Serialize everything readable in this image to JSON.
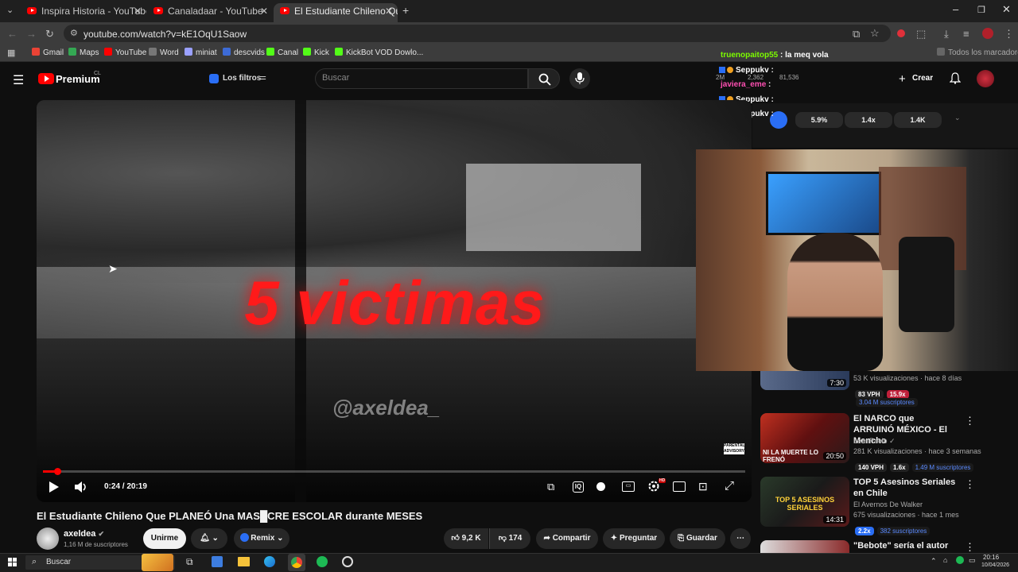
{
  "browser": {
    "tabs": [
      {
        "title": "Inspira Historia - YouTube",
        "active": false
      },
      {
        "title": "Canaladaar - YouTube",
        "active": false
      },
      {
        "title": "El Estudiante Chileno Que PLA",
        "active": true
      }
    ],
    "url": "youtube.com/watch?v=kE1OqU1Saow",
    "bookmarks": [
      "Gmail",
      "Maps",
      "YouTube",
      "Word",
      "miniat",
      "descvids",
      "Canal",
      "Kick",
      "KickBot VOD Dowlo..."
    ],
    "all_bookmarks": "Todos los marcadores"
  },
  "youtube": {
    "logo": "Premium",
    "country": "CL",
    "filters": "Los filtros",
    "search_placeholder": "Buscar",
    "create": "Crear"
  },
  "stats_bar": {
    "subs": "2M",
    "views": "2,362",
    "other": "81,536",
    "pct": "5.9%",
    "mult": "1.4x",
    "k": "1.4K"
  },
  "video": {
    "overlay_text": "5 victimas",
    "watermark": "@axeldea_",
    "time": "0:24 / 20:19",
    "progress_pct": 2,
    "title": "El Estudiante Chileno Que PLANEÓ Una MAS█CRE ESCOLAR durante MESES"
  },
  "channel": {
    "name": "axeldea",
    "subs": "1,16 M de suscriptores",
    "join": "Unirme",
    "remix": "Remix"
  },
  "actions": {
    "likes": "9,2 K",
    "dislikes": "174",
    "share": "Compartir",
    "ask": "Preguntar",
    "save": "Guardar"
  },
  "chat": [
    {
      "user": "truenopaitop55",
      "msg": "la meq vola",
      "color": "#7CFC00"
    },
    {
      "user": "Seppukv",
      "msg": "",
      "color": "#ffffff"
    },
    {
      "user": "javiera_eme",
      "msg": "",
      "color": "#ff4fb2"
    },
    {
      "user": "Seppukv",
      "msg": "",
      "color": "#ffffff"
    },
    {
      "user": "Seppukv",
      "msg": "",
      "color": "#ffffff"
    }
  ],
  "sidebar": [
    {
      "title": "",
      "duration": "7:30",
      "meta": "53 K visualizaciones · hace 8 días",
      "stats": [
        "83 VPH",
        "15.9x"
      ],
      "subs": "3.04 M suscriptores",
      "channel": ""
    },
    {
      "title": "El NARCO que ARRUINÓ MÉXICO - El Mencho",
      "duration": "20:50",
      "channel": "LeanRccio",
      "meta": "281 K visualizaciones · hace 3 semanas",
      "stats": [
        "140 VPH",
        "1.6x"
      ],
      "subs": "1.49 M suscriptores",
      "thumb_text": "NI LA MUERTE LO FRENÓ"
    },
    {
      "title": "TOP 5 Asesinos Seriales en Chile",
      "duration": "14:31",
      "channel": "El Avernos De Walker",
      "meta": "675 visualizaciones · hace 1 mes",
      "stats": [
        "2.2x"
      ],
      "subs": "382 suscriptores",
      "thumb_text": "TOP 5 ASESINOS SERIALES"
    },
    {
      "title": "\"Bebote\" sería el autor del",
      "duration": "",
      "channel": "",
      "meta": "",
      "stats": [],
      "subs": ""
    }
  ],
  "taskbar": {
    "search": "Buscar",
    "time": "20:16",
    "date": "10/04/2026"
  }
}
